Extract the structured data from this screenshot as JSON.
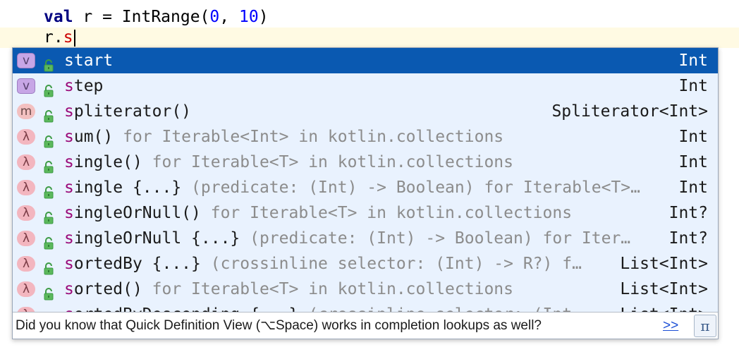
{
  "editor": {
    "line1": {
      "keyword": "val",
      "before_num1": " r = IntRange(",
      "num1": "0",
      "sep": ", ",
      "num2": "10",
      "close": ")"
    },
    "line2": {
      "prefix": "r.",
      "typed": "s"
    }
  },
  "completion": {
    "items": [
      {
        "kind": "v",
        "kind_style": "var",
        "match": "s",
        "rest": "tart",
        "tail": "",
        "type": "Int",
        "selected": true
      },
      {
        "kind": "v",
        "kind_style": "var",
        "match": "s",
        "rest": "tep",
        "tail": "",
        "type": "Int"
      },
      {
        "kind": "m",
        "kind_style": "method",
        "match": "s",
        "rest": "pliterator()",
        "tail": "",
        "type": "Spliterator<Int>"
      },
      {
        "kind": "λ",
        "kind_style": "lambda",
        "match": "s",
        "rest": "um()",
        "tail": " for Iterable<Int> in kotlin.collections",
        "type": "Int"
      },
      {
        "kind": "λ",
        "kind_style": "lambda",
        "match": "s",
        "rest": "ingle()",
        "tail": " for Iterable<T> in kotlin.collections",
        "type": "Int"
      },
      {
        "kind": "λ",
        "kind_style": "lambda",
        "match": "s",
        "rest": "ingle {...}",
        "tail": " (predicate: (Int) -> Boolean) for Iterable<T>…",
        "type": "Int"
      },
      {
        "kind": "λ",
        "kind_style": "lambda",
        "match": "s",
        "rest": "ingleOrNull()",
        "tail": " for Iterable<T> in kotlin.collections",
        "type": "Int?"
      },
      {
        "kind": "λ",
        "kind_style": "lambda",
        "match": "s",
        "rest": "ingleOrNull {...}",
        "tail": " (predicate: (Int) -> Boolean) for Iter…",
        "type": "Int?"
      },
      {
        "kind": "λ",
        "kind_style": "lambda",
        "match": "s",
        "rest": "ortedBy {...}",
        "tail": " (crossinline selector: (Int) -> R?) f…",
        "type": "List<Int>"
      },
      {
        "kind": "λ",
        "kind_style": "lambda",
        "match": "s",
        "rest": "orted()",
        "tail": " for Iterable<T> in kotlin.collections",
        "type": "List<Int>"
      },
      {
        "kind": "λ",
        "kind_style": "lambda",
        "match": "s",
        "rest": "ortedByDescending {...}",
        "tail": " (crossinline selector: (Int",
        "type": "List<Int>"
      }
    ],
    "tip": {
      "text": "Did you know that Quick Definition View (⌥Space) works in completion lookups as well?",
      "link": ">>",
      "pi_button": "π"
    }
  },
  "colors": {
    "selected_bg": "#0a59b1",
    "popup_bg": "#e9f2fe",
    "match_text": "#9a0a79",
    "keyword": "#000080",
    "number": "#0000ff",
    "current_line": "#fffae3"
  }
}
